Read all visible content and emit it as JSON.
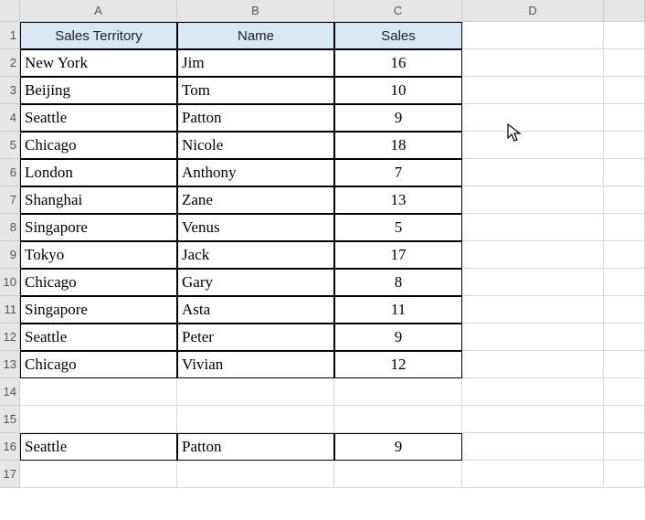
{
  "cols": [
    "A",
    "B",
    "C",
    "D",
    ""
  ],
  "rownums": [
    "1",
    "2",
    "3",
    "4",
    "5",
    "6",
    "7",
    "8",
    "9",
    "10",
    "11",
    "12",
    "13",
    "14",
    "15",
    "16",
    "17"
  ],
  "headers": {
    "a": "Sales Territory",
    "b": "Name",
    "c": "Sales"
  },
  "rows": [
    {
      "territory": "New York",
      "name": "Jim",
      "sales": "16"
    },
    {
      "territory": "Beijing",
      "name": "Tom",
      "sales": "10"
    },
    {
      "territory": "Seattle",
      "name": "Patton",
      "sales": "9"
    },
    {
      "territory": "Chicago",
      "name": "Nicole",
      "sales": "18"
    },
    {
      "territory": "London",
      "name": "Anthony",
      "sales": "7"
    },
    {
      "territory": "Shanghai",
      "name": "Zane",
      "sales": "13"
    },
    {
      "territory": "Singapore",
      "name": "Venus",
      "sales": "5"
    },
    {
      "territory": "Tokyo",
      "name": "Jack",
      "sales": "17"
    },
    {
      "territory": "Chicago",
      "name": "Gary",
      "sales": "8"
    },
    {
      "territory": "Singapore",
      "name": "Asta",
      "sales": "11"
    },
    {
      "territory": "Seattle",
      "name": "Peter",
      "sales": "9"
    },
    {
      "territory": "Chicago",
      "name": "Vivian",
      "sales": "12"
    }
  ],
  "lookup": {
    "territory": "Seattle",
    "name": "Patton",
    "sales": "9"
  }
}
